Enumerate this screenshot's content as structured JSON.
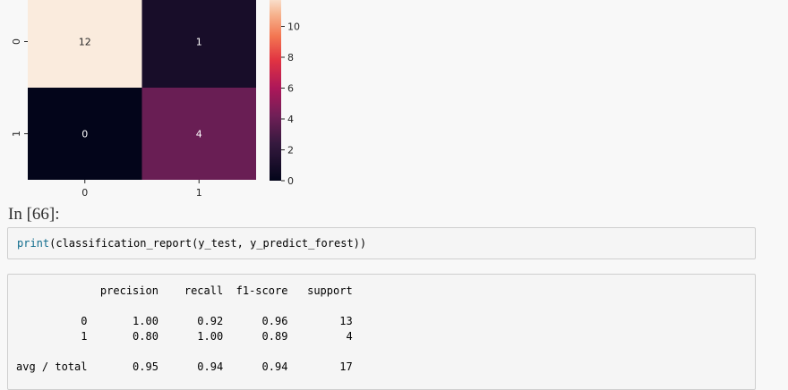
{
  "chart_data": {
    "type": "heatmap",
    "rows": [
      "0",
      "1"
    ],
    "columns": [
      "0",
      "1"
    ],
    "matrix": [
      [
        12,
        1
      ],
      [
        0,
        4
      ]
    ],
    "colorbar": {
      "min": 0,
      "max": 12,
      "ticks": [
        "0",
        "2",
        "4",
        "6",
        "8",
        "10"
      ]
    }
  },
  "cell": {
    "prompt": "In [66]:",
    "code_builtin": "print",
    "code_rest": "(classification_report(y_test, y_predict_forest))"
  },
  "output": {
    "report_text": "             precision    recall  f1-score   support\n\n          0       1.00      0.92      0.96        13\n          1       0.80      1.00      0.89         4\n\navg / total       0.95      0.94      0.94        17"
  }
}
